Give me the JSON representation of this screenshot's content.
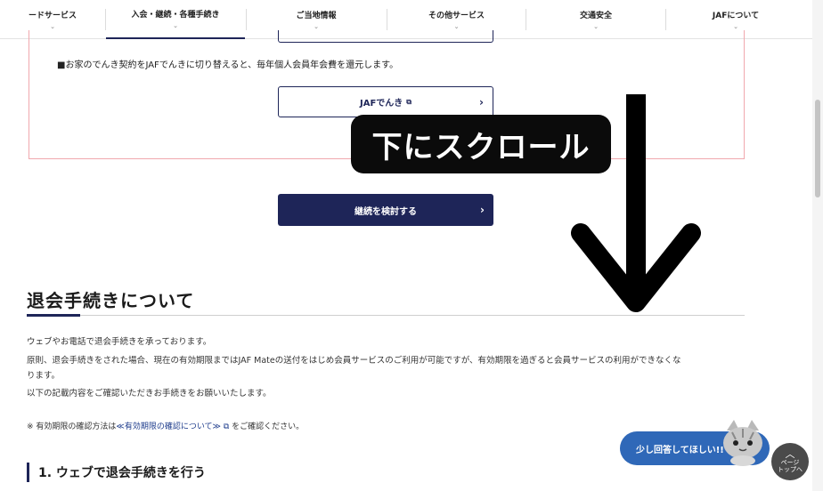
{
  "nav": {
    "items": [
      {
        "label": "ードサービス",
        "chevron": "⌄"
      },
      {
        "label": "入会・継続・各種手続き",
        "chevron": "⌄"
      },
      {
        "label": "ご当地情報",
        "chevron": "⌄"
      },
      {
        "label": "その他サービス",
        "chevron": "⌄"
      },
      {
        "label": "交通安全",
        "chevron": "⌄"
      },
      {
        "label": "JAFについて",
        "chevron": "⌄"
      }
    ]
  },
  "box": {
    "text": "■お家のでんき契約をJAFでんきに切り替えると、毎年個人会員年会費を還元します。",
    "link_label": "JAFでんき",
    "link_icon": "external-link-icon"
  },
  "continue_button": "継続を検討する",
  "section": {
    "title": "退会手続きについて",
    "paragraphs": [
      "ウェブやお電話で退会手続きを承っております。",
      "原則、退会手続きをされた場合、現在の有効期限まではJAF Mateの送付をはじめ会員サービスのご利用が可能ですが、有効期限を過ぎると会員サービスの利用ができなくな",
      "ります。",
      "以下の記載内容をご確認いただきお手続きをお願いいたします。"
    ],
    "note_prefix": "※ 有効期限の確認方法は",
    "note_link": "≪有効期限の確認について≫",
    "note_suffix": "をご確認ください。",
    "step_heading": "1.  ウェブで退会手続きを行う"
  },
  "overlay": {
    "scroll_instruction": "下にスクロール"
  },
  "feedback": {
    "label": "少し回答してほしい!!"
  },
  "page_top": {
    "line1": "ページ",
    "line2": "トップへ"
  },
  "colors": {
    "navy": "#1e2558",
    "pink_border": "#f0a8ae",
    "feedback_blue": "#2f68b8"
  }
}
